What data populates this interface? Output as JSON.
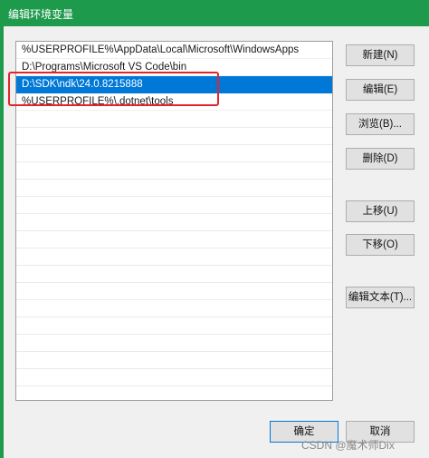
{
  "window": {
    "title": "编辑环境变量"
  },
  "list": {
    "items": [
      {
        "label": "%USERPROFILE%\\AppData\\Local\\Microsoft\\WindowsApps"
      },
      {
        "label": "D:\\Programs\\Microsoft VS Code\\bin"
      },
      {
        "label": "D:\\SDK\\ndk\\24.0.8215888",
        "selected": true
      },
      {
        "label": "%USERPROFILE%\\.dotnet\\tools"
      }
    ]
  },
  "buttons": {
    "new": "新建(N)",
    "edit": "编辑(E)",
    "browse": "浏览(B)...",
    "delete": "删除(D)",
    "move_up": "上移(U)",
    "move_down": "下移(O)",
    "edit_text": "编辑文本(T)...",
    "ok": "确定",
    "cancel": "取消"
  },
  "watermark": "CSDN @魔术师Dix",
  "colors": {
    "titlebar": "#1e9a4c",
    "selection": "#0078d7",
    "annotation": "#e0262a"
  }
}
